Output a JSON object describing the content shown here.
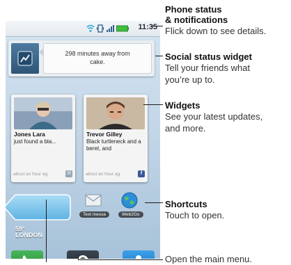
{
  "status_bar": {
    "time": "11:35"
  },
  "social_widget": {
    "status_text": "298 minutes away from cake."
  },
  "widgets": [
    {
      "name": "Jones Lara",
      "text": "just found a bla...",
      "time": "about an hour ag"
    },
    {
      "name": "Trevor Gilley",
      "text": "Black turtleneck and a beret, and",
      "time": "about an hour ag"
    }
  ],
  "weather": {
    "temp": "59°",
    "city": "LONDON"
  },
  "shortcuts": [
    {
      "label": "Text messa",
      "icon": "envelope-icon"
    },
    {
      "label": "Web2Go",
      "icon": "globe-icon"
    }
  ],
  "dock": {
    "phone_icon": "phone-icon",
    "menu_icon": "menu-icon",
    "contacts_icon": "contacts-icon"
  },
  "annotations": {
    "status": {
      "title_line1": "Phone status",
      "title_line2": "& notifications",
      "desc": "Flick down to see details."
    },
    "social": {
      "title": "Social status widget",
      "desc_line1": "Tell your friends what",
      "desc_line2": "you’re up to."
    },
    "widgets": {
      "title": "Widgets",
      "desc_line1": "See your latest updates,",
      "desc_line2": "and more."
    },
    "shortcuts": {
      "title": "Shortcuts",
      "desc": "Touch to open."
    },
    "menu": {
      "desc": "Open the main menu."
    }
  },
  "colors": {
    "dock_green": "#2e9a3e",
    "dock_blue": "#1e7fd0",
    "tab_blue": "#7ec4ec"
  }
}
